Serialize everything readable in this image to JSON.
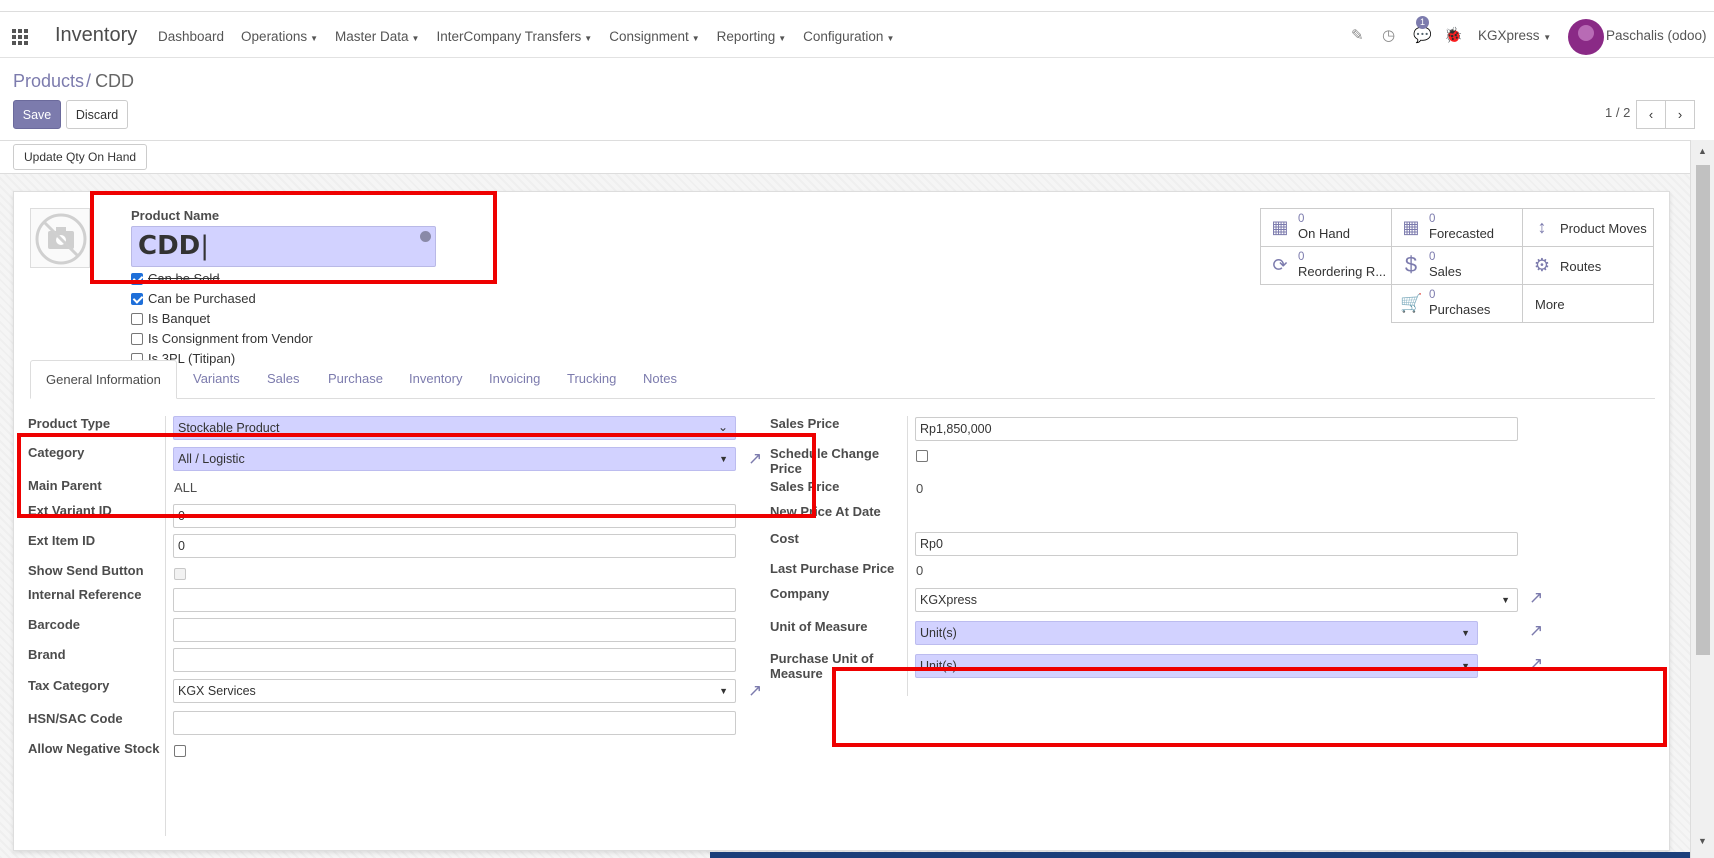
{
  "topbar": {
    "app_name": "Inventory",
    "menu": [
      "Dashboard",
      "Operations",
      "Master Data",
      "InterCompany Transfers",
      "Consignment",
      "Reporting",
      "Configuration"
    ],
    "menu_has_caret": [
      false,
      true,
      true,
      true,
      true,
      true,
      true
    ],
    "message_count": "1",
    "company": "KGXpress",
    "user": "Paschalis (odoo)"
  },
  "control": {
    "breadcrumb_parent": "Products",
    "breadcrumb_sep": "/",
    "breadcrumb_current": "CDD",
    "save_label": "Save",
    "discard_label": "Discard",
    "pager": "1 / 2",
    "pager_prev": "‹",
    "pager_next": "›"
  },
  "statusbar": {
    "update_qty_label": "Update Qty On Hand"
  },
  "product": {
    "name_label": "Product Name",
    "name_value": "CDD",
    "checkboxes": [
      {
        "label": "Can be Sold",
        "checked": true
      },
      {
        "label": "Can be Purchased",
        "checked": true
      },
      {
        "label": "Is Banquet",
        "checked": false
      },
      {
        "label": "Is Consignment from Vendor",
        "checked": false
      },
      {
        "label": "Is 3PL (Titipan)",
        "checked": false
      }
    ]
  },
  "smart_buttons": {
    "on_hand": {
      "value": "0",
      "label": "On Hand"
    },
    "forecasted": {
      "value": "0",
      "label": "Forecasted"
    },
    "product_moves": {
      "label": "Product Moves"
    },
    "reordering": {
      "value": "0",
      "label": "Reordering R..."
    },
    "sales": {
      "value": "0",
      "label": "Sales"
    },
    "routes": {
      "label": "Routes"
    },
    "purchases": {
      "value": "0",
      "label": "Purchases"
    },
    "more": {
      "label": "More"
    }
  },
  "tabs": [
    "General Information",
    "Variants",
    "Sales",
    "Purchase",
    "Inventory",
    "Invoicing",
    "Trucking",
    "Notes"
  ],
  "left": {
    "product_type": {
      "label": "Product Type",
      "value": "Stockable Product"
    },
    "category": {
      "label": "Category",
      "value": "All / Logistic"
    },
    "main_parent": {
      "label": "Main Parent",
      "value": "ALL"
    },
    "ext_variant_id": {
      "label": "Ext Variant ID",
      "value": "0"
    },
    "ext_item_id": {
      "label": "Ext Item ID",
      "value": "0"
    },
    "show_send_button": {
      "label": "Show Send Button"
    },
    "internal_reference": {
      "label": "Internal Reference",
      "value": ""
    },
    "barcode": {
      "label": "Barcode",
      "value": ""
    },
    "brand": {
      "label": "Brand",
      "value": ""
    },
    "tax_category": {
      "label": "Tax Category",
      "value": "KGX Services"
    },
    "hsn_sac_code": {
      "label": "HSN/SAC Code",
      "value": ""
    },
    "allow_negative_stock": {
      "label": "Allow Negative Stock"
    }
  },
  "right": {
    "sales_price": {
      "label": "Sales Price",
      "value": "Rp1,850,000"
    },
    "schedule_change_price": {
      "label_1": "Schedule Change",
      "label_2": "Price"
    },
    "sales_price_2": {
      "label": "Sales Price",
      "value": "0"
    },
    "new_price_at_date": {
      "label": "New Price At Date"
    },
    "cost": {
      "label": "Cost",
      "value": "Rp0"
    },
    "last_purchase_price": {
      "label": "Last Purchase Price",
      "value": "0"
    },
    "company": {
      "label": "Company",
      "value": "KGXpress"
    },
    "uom": {
      "label": "Unit of Measure",
      "value": "Unit(s)"
    },
    "purchase_uom": {
      "label_1": "Purchase Unit of",
      "label_2": "Measure",
      "value": "Unit(s)"
    }
  },
  "colors": {
    "accent": "#7c7bad",
    "required_bg": "#d2d2ff",
    "highlight": "#ee0000"
  }
}
